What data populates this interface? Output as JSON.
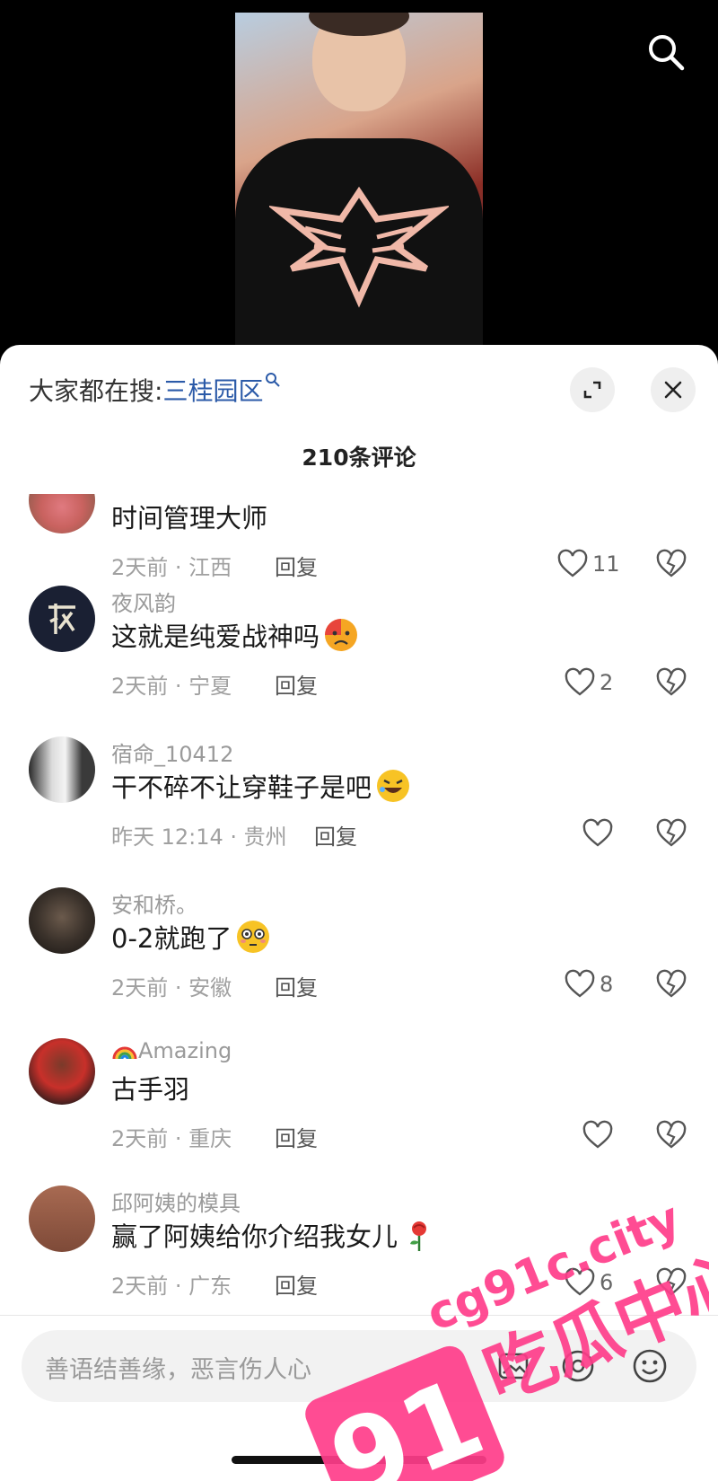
{
  "header": {
    "hot_search_label": "大家都在搜:",
    "hot_search_keyword": "三桂园区",
    "comment_count": "210条评论"
  },
  "comments": [
    {
      "username": "",
      "text": "时间管理大师",
      "time_location": "2天前 · 江西",
      "reply": "回复",
      "likes": "11",
      "emoji": ""
    },
    {
      "username": "夜风韵",
      "text": "这就是纯爱战神吗",
      "time_location": "2天前 · 宁夏",
      "reply": "回复",
      "likes": "2",
      "emoji": "sad-face-emoji"
    },
    {
      "username": "宿命_10412",
      "text": "干不碎不让穿鞋子是吧",
      "time_location": "昨天 12:14 · 贵州",
      "reply": "回复",
      "likes": "",
      "emoji": "rolling-laugh-emoji"
    },
    {
      "username": "安和桥。",
      "text": "0-2就跑了",
      "time_location": "2天前 · 安徽",
      "reply": "回复",
      "likes": "8",
      "emoji": "flushed-face-emoji"
    },
    {
      "username": "Amazing",
      "text": "古手羽",
      "time_location": "2天前 · 重庆",
      "reply": "回复",
      "likes": "",
      "emoji": ""
    },
    {
      "username": "邱阿姨的模具",
      "text": "赢了阿姨给你介绍我女儿",
      "time_location": "2天前 · 广东",
      "reply": "回复",
      "likes": "6",
      "emoji": "rose-emoji"
    }
  ],
  "input": {
    "placeholder": "善语结善缘，恶言伤人心"
  },
  "watermark": {
    "number": "91",
    "site": "cg91c.city",
    "name": "吃瓜中心"
  },
  "colors": {
    "keyword_blue": "#2b5aa8",
    "watermark_pink": "#ff3d8a"
  },
  "icons": [
    "search-icon",
    "expand-icon",
    "close-icon",
    "heart-icon",
    "broken-heart-icon",
    "image-icon",
    "at-icon",
    "emoji-icon"
  ]
}
